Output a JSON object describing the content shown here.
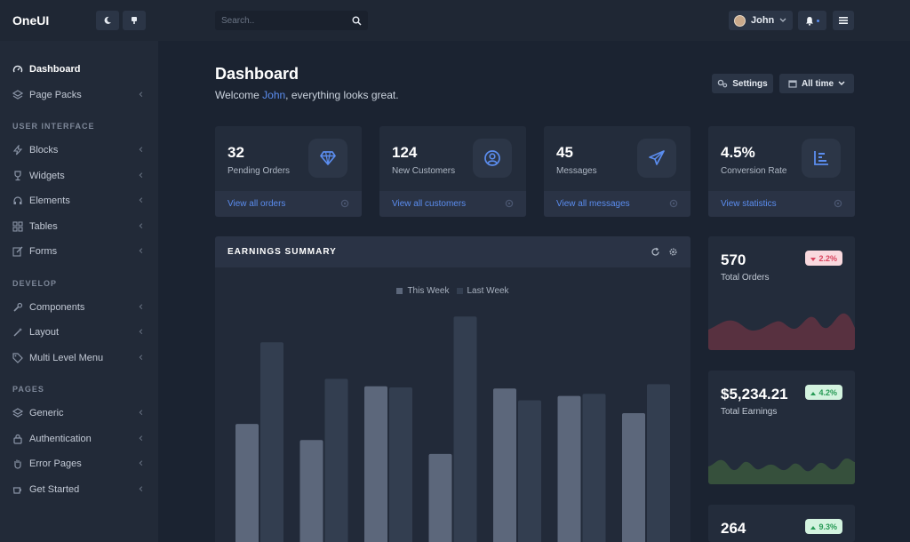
{
  "app": {
    "name": "OneUI"
  },
  "sidebar": {
    "top_items": [
      {
        "label": "Dashboard",
        "icon": "speedometer-icon",
        "active": true
      },
      {
        "label": "Page Packs",
        "icon": "layers-icon"
      }
    ],
    "sections": [
      {
        "heading": "USER INTERFACE",
        "items": [
          {
            "label": "Blocks",
            "icon": "bolt-icon"
          },
          {
            "label": "Widgets",
            "icon": "trophy-icon"
          },
          {
            "label": "Elements",
            "icon": "headset-icon"
          },
          {
            "label": "Tables",
            "icon": "grid-icon"
          },
          {
            "label": "Forms",
            "icon": "edit-icon"
          }
        ]
      },
      {
        "heading": "DEVELOP",
        "items": [
          {
            "label": "Components",
            "icon": "wrench-icon"
          },
          {
            "label": "Layout",
            "icon": "magic-wand-icon"
          },
          {
            "label": "Multi Level Menu",
            "icon": "tags-icon"
          }
        ]
      },
      {
        "heading": "PAGES",
        "items": [
          {
            "label": "Generic",
            "icon": "layers-icon"
          },
          {
            "label": "Authentication",
            "icon": "lock-icon"
          },
          {
            "label": "Error Pages",
            "icon": "hand-icon"
          },
          {
            "label": "Get Started",
            "icon": "coffee-icon"
          }
        ]
      }
    ]
  },
  "header": {
    "search_placeholder": "Search..",
    "user_name": "John"
  },
  "page": {
    "title": "Dashboard",
    "welcome_prefix": "Welcome ",
    "welcome_name": "John",
    "welcome_suffix": ", everything looks great.",
    "settings_label": "Settings",
    "range_label": "All time"
  },
  "stats": [
    {
      "value": "32",
      "label": "Pending Orders",
      "link": "View all orders",
      "icon": "gem-icon"
    },
    {
      "value": "124",
      "label": "New Customers",
      "link": "View all customers",
      "icon": "user-circle-icon"
    },
    {
      "value": "45",
      "label": "Messages",
      "link": "View all messages",
      "icon": "paper-plane-icon"
    },
    {
      "value": "4.5%",
      "label": "Conversion Rate",
      "link": "View statistics",
      "icon": "bar-chart-icon"
    }
  ],
  "earnings": {
    "title": "EARNINGS SUMMARY"
  },
  "chart_data": {
    "type": "bar",
    "title": "EARNINGS SUMMARY",
    "series": [
      {
        "name": "This Week",
        "color": "#5c677b",
        "values": [
          1100,
          950,
          1450,
          820,
          1430,
          1360,
          1200
        ]
      },
      {
        "name": "Last Week",
        "color": "#333e50",
        "values": [
          1860,
          1520,
          1440,
          2100,
          1320,
          1380,
          1470
        ]
      }
    ],
    "ylim": [
      0,
      2400
    ],
    "grid": false,
    "legend": "top-center"
  },
  "mini_cards": [
    {
      "value": "570",
      "label": "Total Orders",
      "badge": "2.2%",
      "trend": "down",
      "color": "#e4414f"
    },
    {
      "value": "$5,234.21",
      "label": "Total Earnings",
      "badge": "4.2%",
      "trend": "up",
      "color": "#68b042"
    },
    {
      "value": "264",
      "label": "",
      "badge": "9.3%",
      "trend": "up",
      "color": "#3b82f6"
    }
  ],
  "colors": {
    "accent": "#5b8def",
    "bg": "#1b2331",
    "card": "#232c3b"
  }
}
